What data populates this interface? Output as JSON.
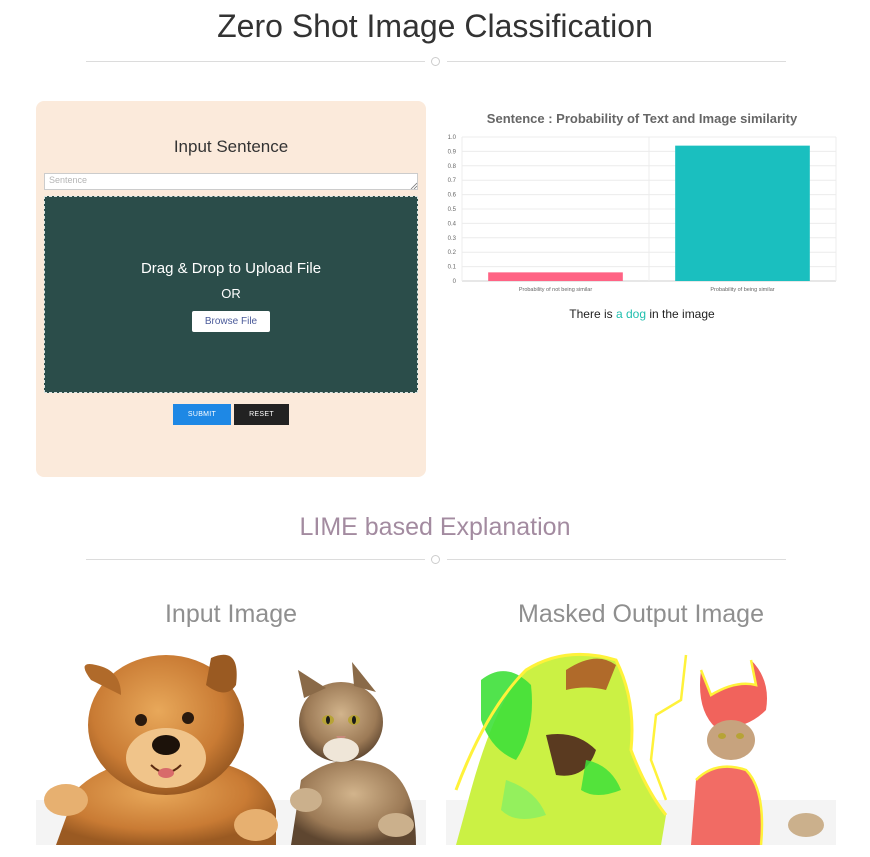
{
  "page": {
    "title": "Zero Shot Image Classification"
  },
  "input_card": {
    "title": "Input Sentence",
    "sentence_placeholder": "Sentence",
    "sentence_value": "",
    "dropzone_title": "Drag & Drop to Upload File",
    "dropzone_or": "OR",
    "browse_label": "Browse File",
    "submit_label": "SUBMIT",
    "reset_label": "RESET"
  },
  "chart_data": {
    "type": "bar",
    "title": "Sentence : Probability of Text and Image similarity",
    "categories": [
      "Probability of not being similar",
      "Probability of being similar"
    ],
    "values": [
      0.06,
      0.94
    ],
    "colors": [
      "#ff6384",
      "#1abfbf"
    ],
    "ylim": [
      0,
      1.0
    ],
    "yticks": [
      "0",
      "0.1",
      "0.2",
      "0.3",
      "0.4",
      "0.5",
      "0.6",
      "0.7",
      "0.8",
      "0.9",
      "1.0"
    ],
    "grid": true,
    "legend": "none"
  },
  "result": {
    "prefix": "There is ",
    "highlight": "a dog",
    "suffix": " in the image",
    "highlight_color": "#1fbfae"
  },
  "explanation": {
    "section_title": "LIME based Explanation",
    "input_image_title": "Input Image",
    "output_image_title": "Masked Output Image"
  }
}
